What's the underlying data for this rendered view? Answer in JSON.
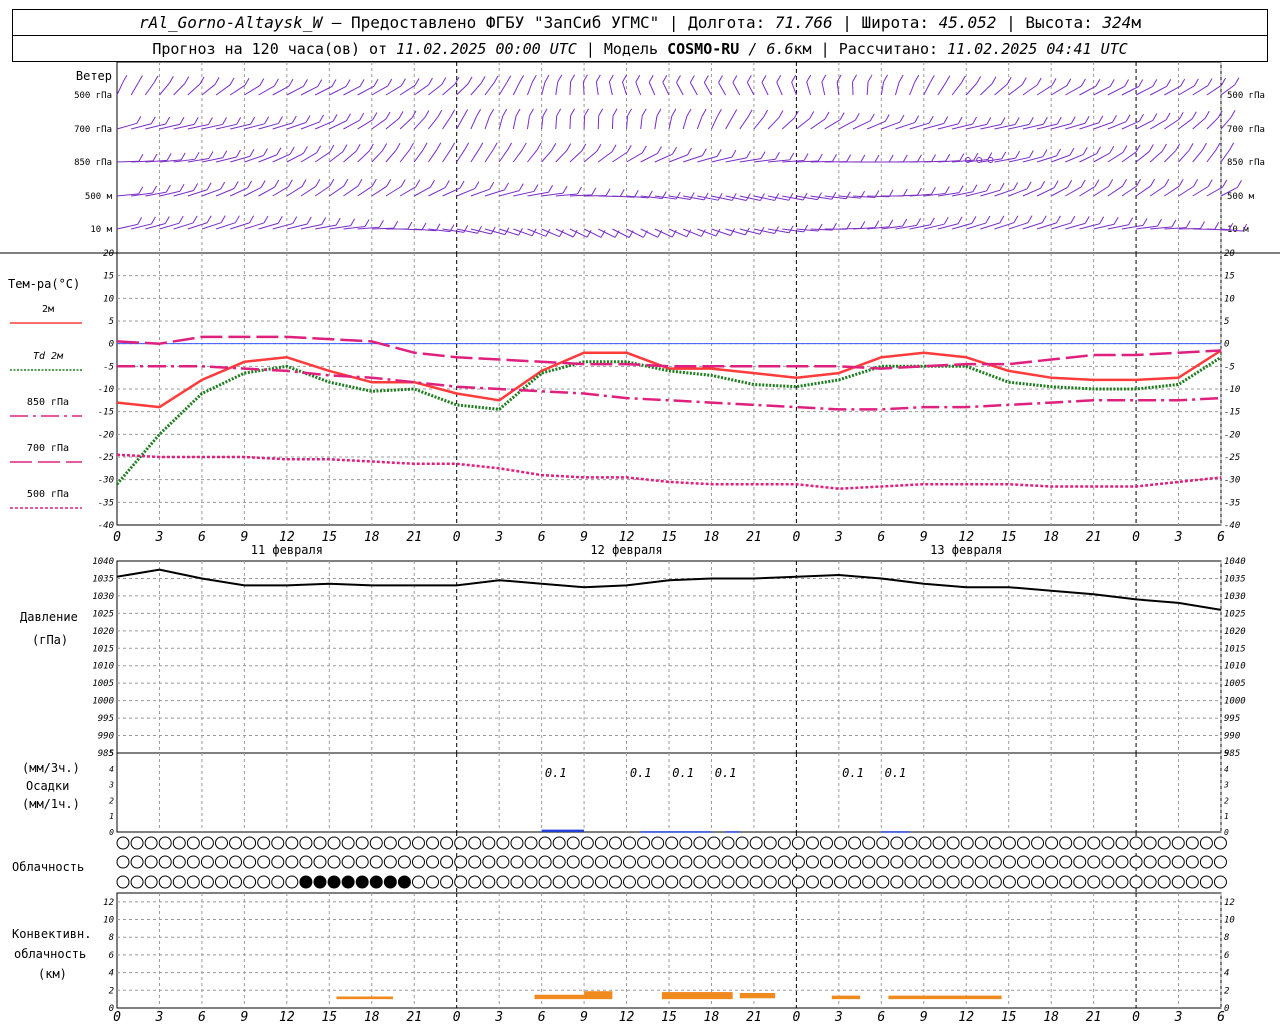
{
  "header": {
    "station": "rAl_Gorno-Altaysk_W",
    "provided_by": "– Предоставлено ФГБУ \"ЗапСиб УГМС\"",
    "lon_label": "Долгота:",
    "lon_value": "71.766",
    "lat_label": "Широта:",
    "lat_value": "45.052",
    "alt_label": "Высота:",
    "alt_value": "324",
    "alt_unit": "м",
    "forecast_label": "Прогноз на 120 часа(ов) от",
    "forecast_start": "11.02.2025 00:00 UTC",
    "model_label": "Модель",
    "model_name": "COSMO-RU",
    "model_res": "/ 6.6",
    "model_res_unit": "км",
    "calc_label": "Рассчитано:",
    "calc_time": "11.02.2025 04:41 UTC"
  },
  "panels": {
    "wind": {
      "title": "Ветер",
      "levels": [
        "500 гПа",
        "700 гПа",
        "850 гПа",
        "500 м",
        "10  м"
      ]
    },
    "temperature": {
      "title": "Тем-ра(°C)",
      "legend": [
        {
          "label": "2м",
          "color": "#ff3b3b",
          "style": "solid"
        },
        {
          "label": "Td  2м",
          "color": "#1e7d1e",
          "style": "dotted"
        },
        {
          "label": "850 гПа",
          "color": "#e0207e",
          "style": "dashdot"
        },
        {
          "label": "700 гПа",
          "color": "#e0207e",
          "style": "dashed"
        },
        {
          "label": "500 гПа",
          "color": "#e0207e",
          "style": "dotted"
        }
      ]
    },
    "pressure": {
      "title_1": "Давление",
      "title_2": "(гПа)"
    },
    "precip": {
      "title_1": "(мм/3ч.)",
      "title_2": "Осадки",
      "title_3": "(мм/1ч.)"
    },
    "cloud": {
      "title": "Облачность"
    },
    "convective": {
      "title_1": "Конвективн.",
      "title_2": "облачность",
      "title_3": "(км)"
    }
  },
  "chart_data": {
    "type": "line",
    "x_hours": [
      0,
      3,
      6,
      9,
      12,
      15,
      18,
      21,
      24,
      27,
      30,
      33,
      36,
      39,
      42,
      45,
      48,
      51,
      54,
      57,
      60,
      63,
      66,
      69,
      72,
      75,
      78
    ],
    "x_tick_labels": [
      "0",
      "3",
      "6",
      "9",
      "12",
      "15",
      "18",
      "21",
      "0",
      "3",
      "6",
      "9",
      "12",
      "15",
      "18",
      "21",
      "0",
      "3",
      "6",
      "9",
      "12",
      "15",
      "18",
      "21",
      "0",
      "3",
      "6"
    ],
    "date_labels": [
      {
        "hour": 12,
        "label": "11 февраля"
      },
      {
        "hour": 36,
        "label": "12 февраля"
      },
      {
        "hour": 60,
        "label": "13 февраля"
      }
    ],
    "temperature": {
      "ylim": [
        -40,
        20
      ],
      "ticks": [
        20,
        15,
        10,
        5,
        0,
        -5,
        -10,
        -15,
        -20,
        -25,
        -30,
        -35,
        -40
      ],
      "series": [
        {
          "name": "2м",
          "values": [
            -13,
            -14,
            -8,
            -4,
            -3,
            -6,
            -8.5,
            -8.5,
            -11,
            -12.5,
            -6,
            -2,
            -2,
            -5.5,
            -5.5,
            -6.5,
            -7.5,
            -6.5,
            -3,
            -2,
            -3,
            -6,
            -7.5,
            -8,
            -8,
            -7.5,
            -1.5
          ]
        },
        {
          "name": "Td 2м",
          "values": [
            -31,
            -20,
            -11,
            -6.5,
            -5,
            -8.5,
            -10.5,
            -10,
            -13.5,
            -14.5,
            -6.5,
            -4,
            -4,
            -6,
            -7,
            -9,
            -9.5,
            -8,
            -5,
            -5,
            -5,
            -8.5,
            -9.5,
            -10,
            -10,
            -9,
            -3
          ]
        },
        {
          "name": "850 гПа",
          "values": [
            -5,
            -5,
            -5,
            -5.5,
            -6,
            -7,
            -7.5,
            -8.5,
            -9.5,
            -10,
            -10.5,
            -11,
            -12,
            -12.5,
            -13,
            -13.5,
            -14,
            -14.5,
            -14.5,
            -14,
            -14,
            -13.5,
            -13,
            -12.5,
            -12.5,
            -12.5,
            -12
          ]
        },
        {
          "name": "700 гПа",
          "values": [
            0.5,
            0,
            1.5,
            1.5,
            1.5,
            1,
            0.5,
            -2,
            -3,
            -3.5,
            -4,
            -4.5,
            -4.5,
            -5,
            -5,
            -5,
            -5,
            -5,
            -5.5,
            -5,
            -4.5,
            -4.5,
            -3.5,
            -2.5,
            -2.5,
            -2,
            -1.5
          ]
        },
        {
          "name": "500 гПа",
          "values": [
            -24.5,
            -25,
            -25,
            -25,
            -25.5,
            -25.5,
            -26,
            -26.5,
            -26.5,
            -27.5,
            -29,
            -29.5,
            -29.5,
            -30.5,
            -31,
            -31,
            -31,
            -32,
            -31.5,
            -31,
            -31,
            -31,
            -31.5,
            -31.5,
            -31.5,
            -30.5,
            -29.5
          ]
        }
      ]
    },
    "pressure": {
      "ylim": [
        985,
        1040
      ],
      "ticks": [
        1040,
        1035,
        1030,
        1025,
        1020,
        1015,
        1010,
        1005,
        1000,
        995,
        990,
        985
      ],
      "series": [
        {
          "name": "",
          "values": [
            1035.5,
            1037.5,
            1035,
            1033,
            1033,
            1033.5,
            1033,
            1033,
            1033,
            1034.5,
            1033.5,
            1032.5,
            1033,
            1034.5,
            1035,
            1035,
            1035.5,
            1036,
            1035,
            1033.5,
            1032.5,
            1032.5,
            1031.5,
            1030.5,
            1029,
            1028,
            1026
          ]
        }
      ]
    },
    "precipitation": {
      "ylim": [
        0,
        5
      ],
      "ticks": [
        5,
        4,
        3,
        2,
        1,
        0
      ],
      "labels": [
        {
          "hour": 31,
          "label": "0.1"
        },
        {
          "hour": 37,
          "label": "0.1"
        },
        {
          "hour": 40,
          "label": "0.1"
        },
        {
          "hour": 43,
          "label": "0.1"
        },
        {
          "hour": 52,
          "label": "0.1"
        },
        {
          "hour": 55,
          "label": "0.1"
        }
      ],
      "bars": [
        {
          "from": 30,
          "to": 33,
          "value": 0.15
        },
        {
          "from": 37,
          "to": 42,
          "value": 0.05
        },
        {
          "from": 43,
          "to": 44,
          "value": 0.05
        },
        {
          "from": 54,
          "to": 56,
          "value": 0.05
        }
      ]
    },
    "cloud_cover": {
      "scale": "octas 0-8 (0 = clear circle, 8 = filled circle)",
      "rows": [
        {
          "level": "high",
          "values": [
            0,
            0,
            0,
            0,
            0,
            0,
            0,
            0,
            0,
            0,
            0,
            0,
            0,
            0,
            0,
            0,
            0,
            0,
            0,
            0,
            0,
            0,
            0,
            0,
            0,
            0,
            0,
            0,
            0,
            0,
            0,
            0,
            0,
            0,
            0,
            0,
            0,
            0,
            0,
            0,
            0,
            0,
            0,
            0,
            0,
            0,
            0,
            0,
            0,
            0,
            0,
            0,
            0,
            0,
            0,
            0,
            0,
            0,
            0,
            0,
            0,
            0,
            0,
            0,
            0,
            0,
            0,
            0,
            0,
            0,
            0,
            0,
            0,
            0,
            0,
            0,
            0,
            0,
            0
          ]
        },
        {
          "level": "middle",
          "values": [
            0,
            0,
            0,
            0,
            0,
            0,
            0,
            0,
            0,
            0,
            0,
            0,
            0,
            0,
            0,
            0,
            0,
            0,
            0,
            0,
            0,
            0,
            0,
            0,
            0,
            0,
            0,
            0,
            0,
            0,
            0,
            0,
            0,
            0,
            0,
            0,
            0,
            0,
            0,
            0,
            0,
            0,
            0,
            0,
            0,
            0,
            0,
            0,
            0,
            0,
            0,
            0,
            0,
            0,
            0,
            0,
            0,
            0,
            0,
            0,
            0,
            0,
            0,
            0,
            0,
            0,
            0,
            0,
            0,
            0,
            0,
            0,
            0,
            0,
            0,
            0,
            0,
            0,
            0
          ]
        },
        {
          "level": "low",
          "values": [
            0,
            0,
            0,
            0,
            0,
            0,
            0,
            0,
            0,
            0,
            0,
            0,
            0,
            8,
            8,
            8,
            8,
            8,
            8,
            8,
            8,
            0,
            0,
            0,
            0,
            0,
            0,
            0,
            0,
            0,
            0,
            0,
            0,
            0,
            0,
            0,
            0,
            0,
            0,
            0,
            0,
            0,
            0,
            0,
            0,
            0,
            0,
            0,
            0,
            0,
            0,
            0,
            0,
            0,
            0,
            0,
            0,
            0,
            0,
            0,
            0,
            0,
            0,
            0,
            0,
            0,
            0,
            0,
            0,
            0,
            0,
            0,
            0,
            0,
            0,
            0,
            0,
            0,
            0
          ]
        }
      ]
    },
    "convective": {
      "ylim": [
        0,
        13
      ],
      "ticks": [
        12,
        10,
        8,
        6,
        4,
        2,
        0
      ],
      "segments": [
        {
          "from": 15.5,
          "to": 19.5,
          "bottom": 1.0,
          "top": 1.3
        },
        {
          "from": 29.5,
          "to": 33,
          "bottom": 1.0,
          "top": 1.5
        },
        {
          "from": 33,
          "to": 35,
          "bottom": 1.0,
          "top": 1.9
        },
        {
          "from": 38.5,
          "to": 43.5,
          "bottom": 1.0,
          "top": 1.8
        },
        {
          "from": 44,
          "to": 46.5,
          "bottom": 1.1,
          "top": 1.7
        },
        {
          "from": 50.5,
          "to": 52.5,
          "bottom": 1.0,
          "top": 1.4
        },
        {
          "from": 54.5,
          "to": 62.5,
          "bottom": 1.0,
          "top": 1.4
        }
      ]
    },
    "colors": {
      "t2m": "#ff3b3b",
      "td2m": "#1e7d1e",
      "upper": "#e0207e",
      "pressure": "#000000",
      "precip": "#1f3fd6",
      "convective": "#f08a1e",
      "wind": "#7a2cc7",
      "grid": "#9a9a9a",
      "zero_line": "#3b5bff"
    }
  }
}
